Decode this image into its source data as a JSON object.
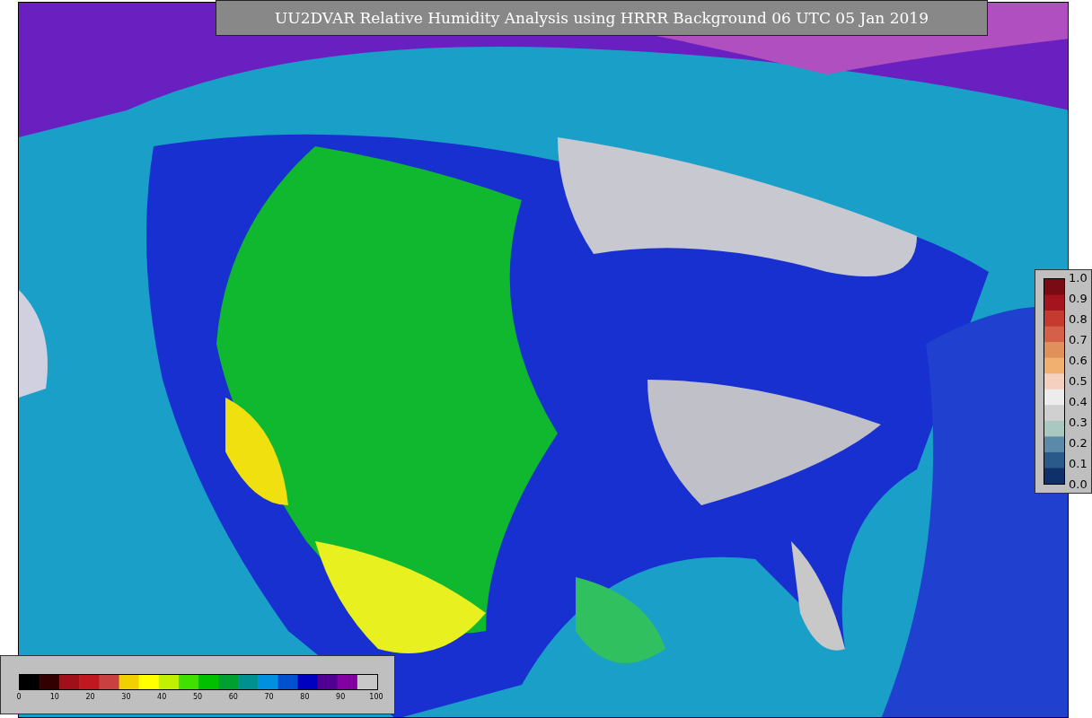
{
  "title": "UU2DVAR Relative Humidity Analysis using HRRR Background 06 UTC 05 Jan 2019",
  "colorbar_right": {
    "labels": [
      "1.0",
      "0.9",
      "0.8",
      "0.7",
      "0.6",
      "0.5",
      "0.4",
      "0.3",
      "0.2",
      "0.1",
      "0.0"
    ]
  },
  "colorbar_bottom": {
    "labels": [
      "0",
      "10",
      "20",
      "30",
      "40",
      "50",
      "60",
      "70",
      "80",
      "90",
      "100"
    ]
  }
}
